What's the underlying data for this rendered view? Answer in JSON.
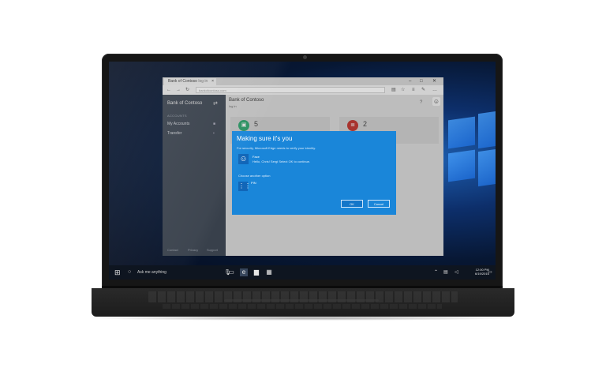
{
  "browser": {
    "tab_title": "Bank of Contoso",
    "tab_subtitle": "log in",
    "address": "bankofcontoso.com",
    "minimize": "–",
    "maximize": "□",
    "close": "✕"
  },
  "sidebar": {
    "title": "Bank of Contoso",
    "section_heading": "ACCOUNTS",
    "items": [
      {
        "label": "My Accounts"
      },
      {
        "label": "Transfer"
      }
    ],
    "footer": [
      "Contact",
      "Privacy",
      "Support"
    ]
  },
  "content": {
    "title": "Bank of Contoso",
    "subtitle": "log in",
    "cards": [
      {
        "number": "5",
        "color": "#27a36a"
      },
      {
        "number": "2",
        "color": "#c0332d"
      }
    ]
  },
  "dialog": {
    "title": "Making sure it's you",
    "description": "For security, Microsoft Edge needs to verify your identity.",
    "option_title": "Face",
    "option_description": "Hello, Chris! Sergi Select OK to continue.",
    "choose_label": "Choose another option",
    "pin_label": "PIN",
    "ok_label": "OK",
    "cancel_label": "Cancel",
    "accent_color": "#1a86d9"
  },
  "taskbar": {
    "search_placeholder": "Ask me anything",
    "clock_time": "12:00 PM",
    "clock_date": "6/19/2016"
  }
}
